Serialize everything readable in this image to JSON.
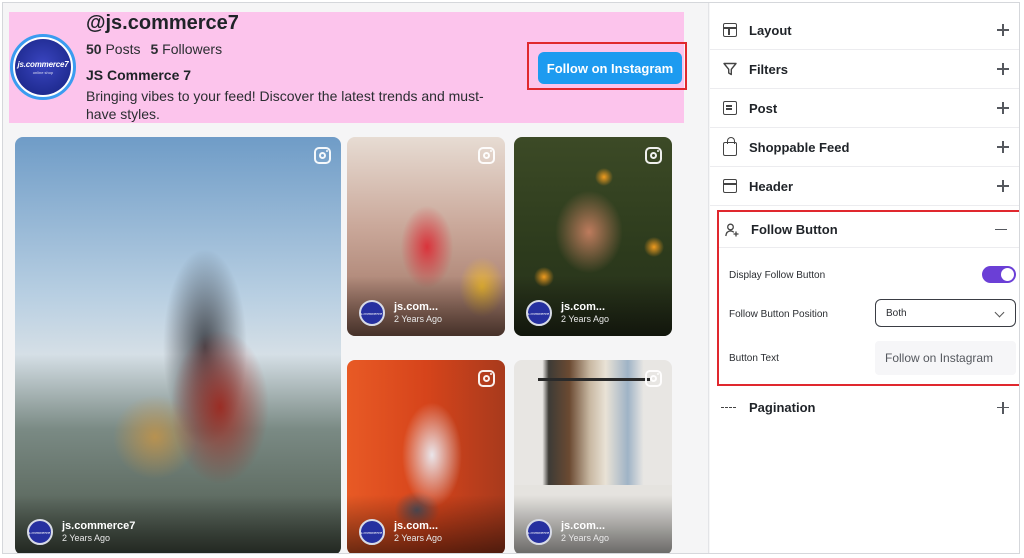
{
  "header": {
    "handle": "@js.commerce7",
    "posts_count": "50",
    "posts_label": "Posts",
    "followers_count": "5",
    "followers_label": "Followers",
    "business_name": "JS Commerce 7",
    "bio": "Bringing vibes to your feed! Discover the latest trends and must-have styles.",
    "avatar_text": "js.commerce7",
    "avatar_subtext": "online shop",
    "follow_button_label": "Follow on Instagram"
  },
  "feed": {
    "posts": [
      {
        "username": "js.commerce7",
        "time": "2 Years Ago"
      },
      {
        "username": "js.com...",
        "time": "2 Years Ago"
      },
      {
        "username": "js.com...",
        "time": "2 Years Ago"
      },
      {
        "username": "js.com...",
        "time": "2 Years Ago"
      },
      {
        "username": "js.com...",
        "time": "2 Years Ago"
      }
    ],
    "mini_avatar_text": "js.commerce7"
  },
  "settings": {
    "sections": [
      {
        "label": "Layout",
        "icon": "layout-icon"
      },
      {
        "label": "Filters",
        "icon": "filter-icon"
      },
      {
        "label": "Post",
        "icon": "post-icon"
      },
      {
        "label": "Shoppable Feed",
        "icon": "shopping-bag-icon"
      },
      {
        "label": "Header",
        "icon": "header-icon"
      }
    ],
    "follow_button": {
      "label": "Follow Button",
      "icon": "user-plus-icon",
      "display_label": "Display Follow Button",
      "display_enabled": true,
      "position_label": "Follow Button Position",
      "position_value": "Both",
      "text_label": "Button Text",
      "text_value": "Follow on Instagram"
    },
    "pagination": {
      "label": "Pagination",
      "icon": "pagination-icon"
    }
  },
  "colors": {
    "header_bg": "#fcc4ec",
    "follow_button": "#1d9bf0",
    "toggle_on": "#6b3fd6",
    "highlight": "#e0282e"
  }
}
